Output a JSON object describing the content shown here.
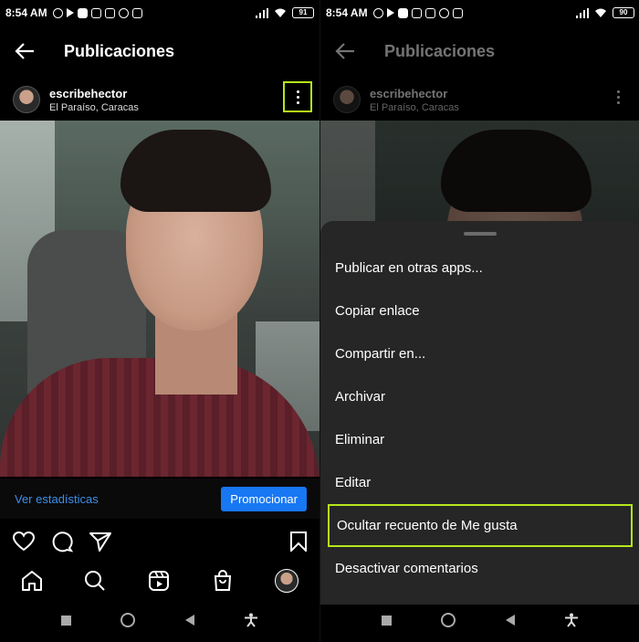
{
  "status_left": {
    "time": "8:54 AM",
    "battery": "91"
  },
  "status_right": {
    "time": "8:54 AM",
    "battery": "90"
  },
  "topbar": {
    "title": "Publicaciones"
  },
  "post": {
    "username": "escribehector",
    "location": "El Paraíso, Caracas",
    "insights_label": "Ver estadísticas",
    "promote_label": "Promocionar"
  },
  "options_menu": [
    "Publicar en otras apps...",
    "Copiar enlace",
    "Compartir en...",
    "Archivar",
    "Eliminar",
    "Editar",
    "Ocultar recuento de Me gusta",
    "Desactivar comentarios"
  ],
  "colors": {
    "highlight": "#b6e61a",
    "link": "#3d8eea",
    "promote": "#1877f2",
    "sheet": "#262626"
  }
}
